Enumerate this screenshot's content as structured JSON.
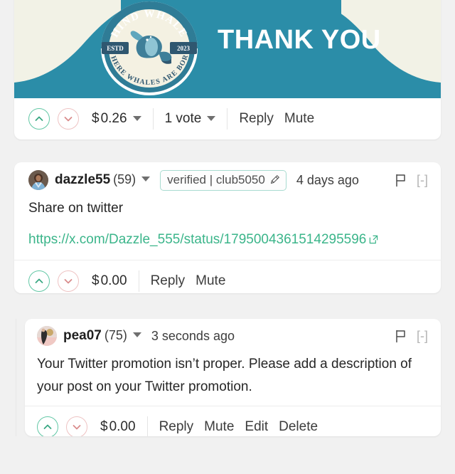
{
  "theme": {
    "page_bg": "#f1f1f1",
    "card_bg": "#ffffff",
    "accent_teal": "#2b8da8",
    "banner_cream": "#f2f2e6",
    "link_green": "#3bb58a",
    "upvote_green": "#62c7a5",
    "downvote_pink": "#eec3c3"
  },
  "post": {
    "banner": {
      "title": "THANK YOU",
      "logo": {
        "top_text": "HIND WHALE",
        "bottom_text": "WHERE WHALES ARE BORN",
        "left_badge": "ESTD",
        "right_badge": "2023",
        "icon_name": "whale-emblem-icon"
      }
    },
    "actions": {
      "upvote_icon": "chevron-up-icon",
      "downvote_icon": "chevron-down-icon",
      "payout_currency": "$",
      "payout_value": "0.26",
      "votes_label": "1 vote",
      "reply_label": "Reply",
      "mute_label": "Mute"
    }
  },
  "comments": [
    {
      "author": "dazzle55",
      "reputation": "(59)",
      "badge_text": "verified | club5050",
      "badge_icon": "pen-nib-icon",
      "time": "4 days ago",
      "flag_icon": "flag-icon",
      "collapse_label": "[-]",
      "body_text": "Share on twitter",
      "link_text": "https://x.com/Dazzle_555/status/1795004361514295596",
      "link_icon": "external-link-icon",
      "actions": {
        "upvote_icon": "chevron-up-icon",
        "downvote_icon": "chevron-down-icon",
        "payout_currency": "$",
        "payout_value": "0.00",
        "reply_label": "Reply",
        "mute_label": "Mute"
      }
    },
    {
      "author": "pea07",
      "reputation": "(75)",
      "time": "3 seconds ago",
      "flag_icon": "flag-icon",
      "collapse_label": "[-]",
      "body_text": "Your Twitter promotion isn’t proper. Please add a description of your post on your Twitter promotion.",
      "actions": {
        "upvote_icon": "chevron-up-icon",
        "downvote_icon": "chevron-down-icon",
        "payout_currency": "$",
        "payout_value": "0.00",
        "reply_label": "Reply",
        "mute_label": "Mute",
        "edit_label": "Edit",
        "delete_label": "Delete"
      }
    }
  ]
}
